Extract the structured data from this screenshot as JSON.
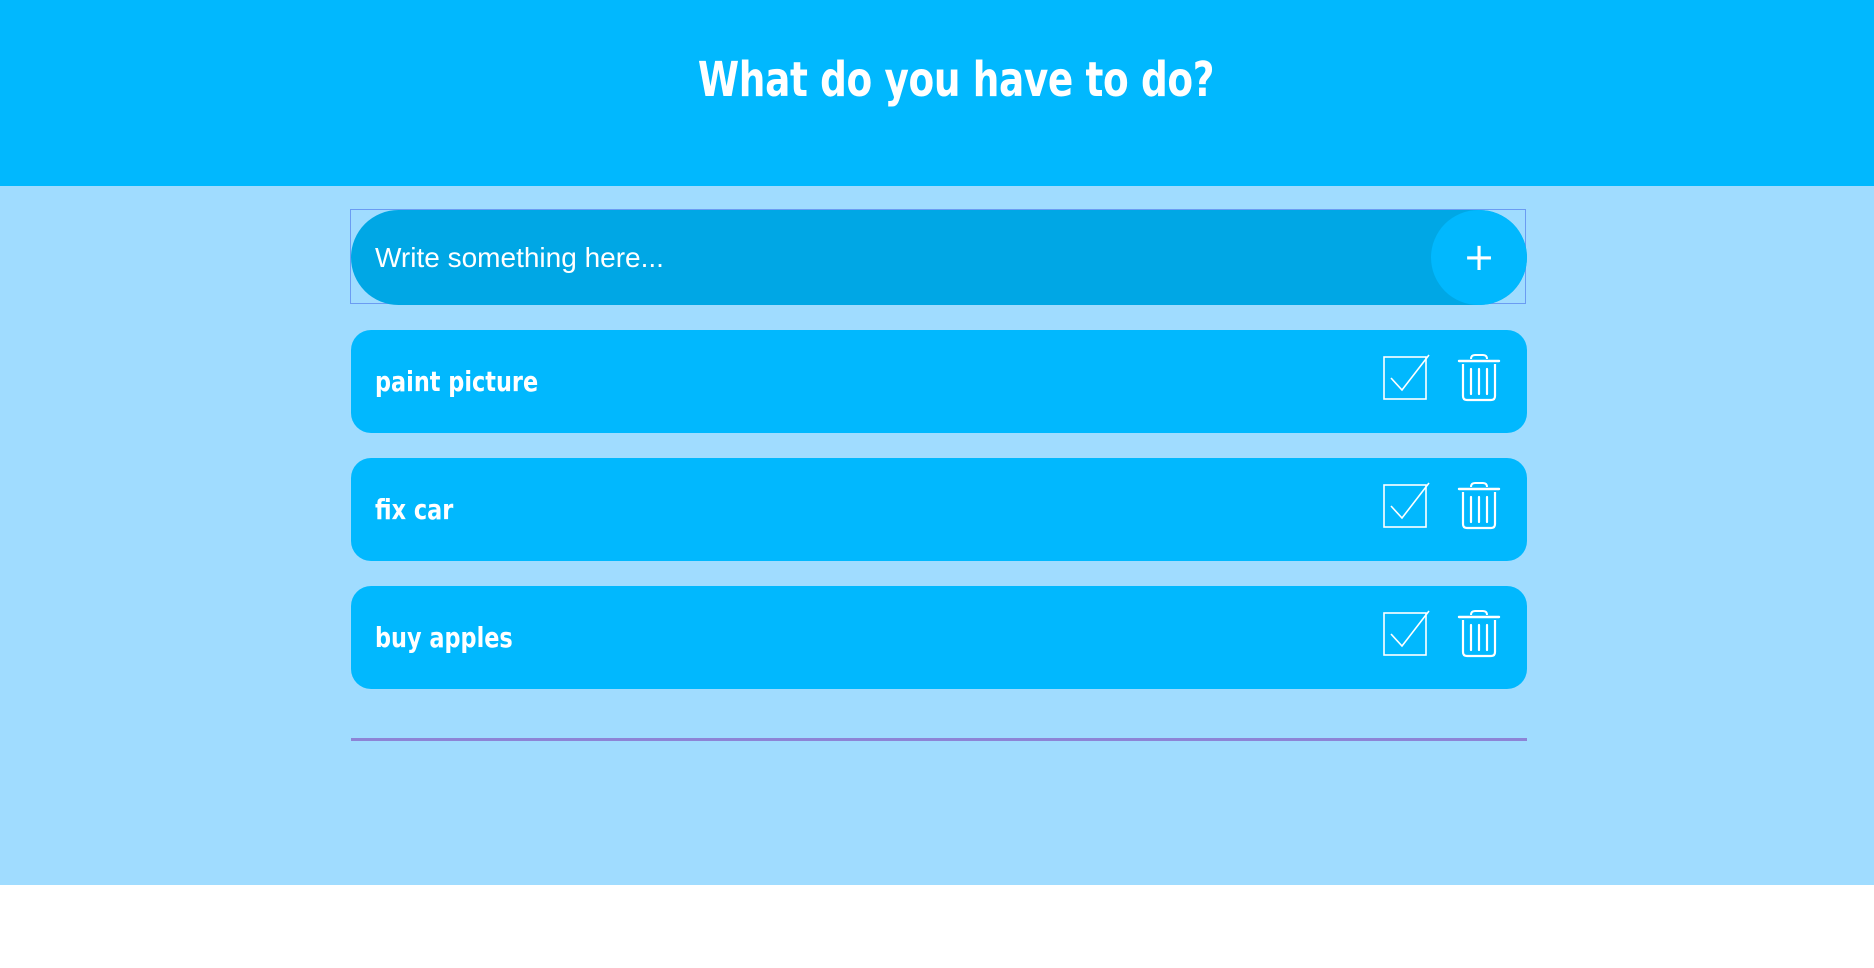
{
  "header": {
    "title": "What do you have to do?"
  },
  "new_task": {
    "placeholder": "Write something here...",
    "value": "",
    "add_label": "+"
  },
  "todos": [
    {
      "label": "paint picture"
    },
    {
      "label": "fix car"
    },
    {
      "label": "buy apples"
    }
  ],
  "icons": {
    "complete": "checkbox-check-icon",
    "delete": "trash-icon"
  },
  "colors": {
    "header_bg": "#01b8fe",
    "page_bg": "#a0dcff",
    "input_bg": "#00a7e5",
    "item_bg": "#01b8fe",
    "divider": "#8d84d6",
    "text": "#ffffff"
  }
}
